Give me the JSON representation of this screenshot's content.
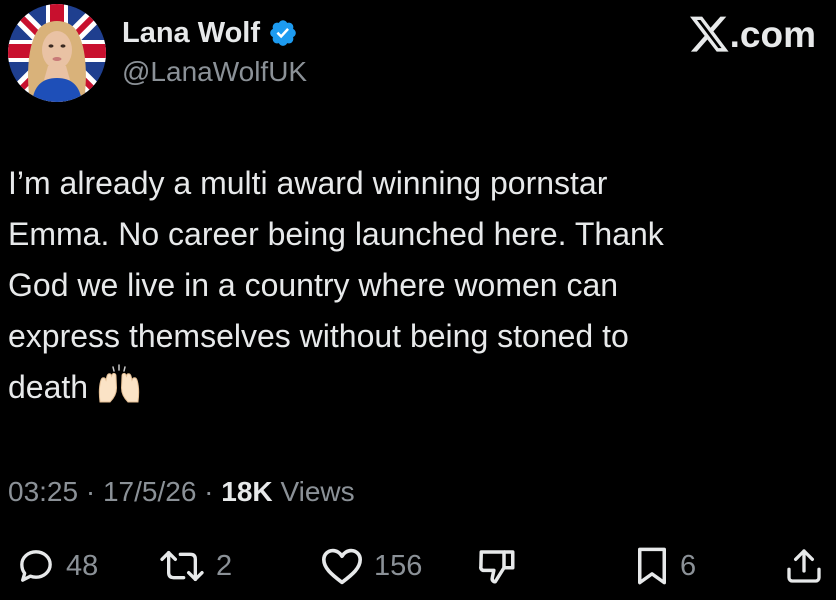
{
  "author": {
    "display_name": "Lana Wolf",
    "handle": "@LanaWolfUK",
    "verified": true,
    "avatar": "profile-photo"
  },
  "brand": {
    "domain": ".com",
    "icon": "x-logo-icon"
  },
  "tweet": {
    "lines": [
      "I’m already a multi award winning pornstar",
      "Emma. No career being launched here. Thank",
      "God we live in a country where women can",
      "express themselves without being stoned to",
      "death"
    ],
    "emoji": "raising-hands-emoji"
  },
  "meta": {
    "time": "03:25",
    "separator": "·",
    "date": "17/5/26",
    "views_count": "18K",
    "views_label": "Views"
  },
  "actions": {
    "replies": "48",
    "reposts": "2",
    "likes": "156",
    "bookmarks": "6"
  },
  "colors": {
    "background": "#000000",
    "text": "#e7e9ea",
    "secondary": "#8b9197",
    "verified": "#1d9bf0"
  }
}
